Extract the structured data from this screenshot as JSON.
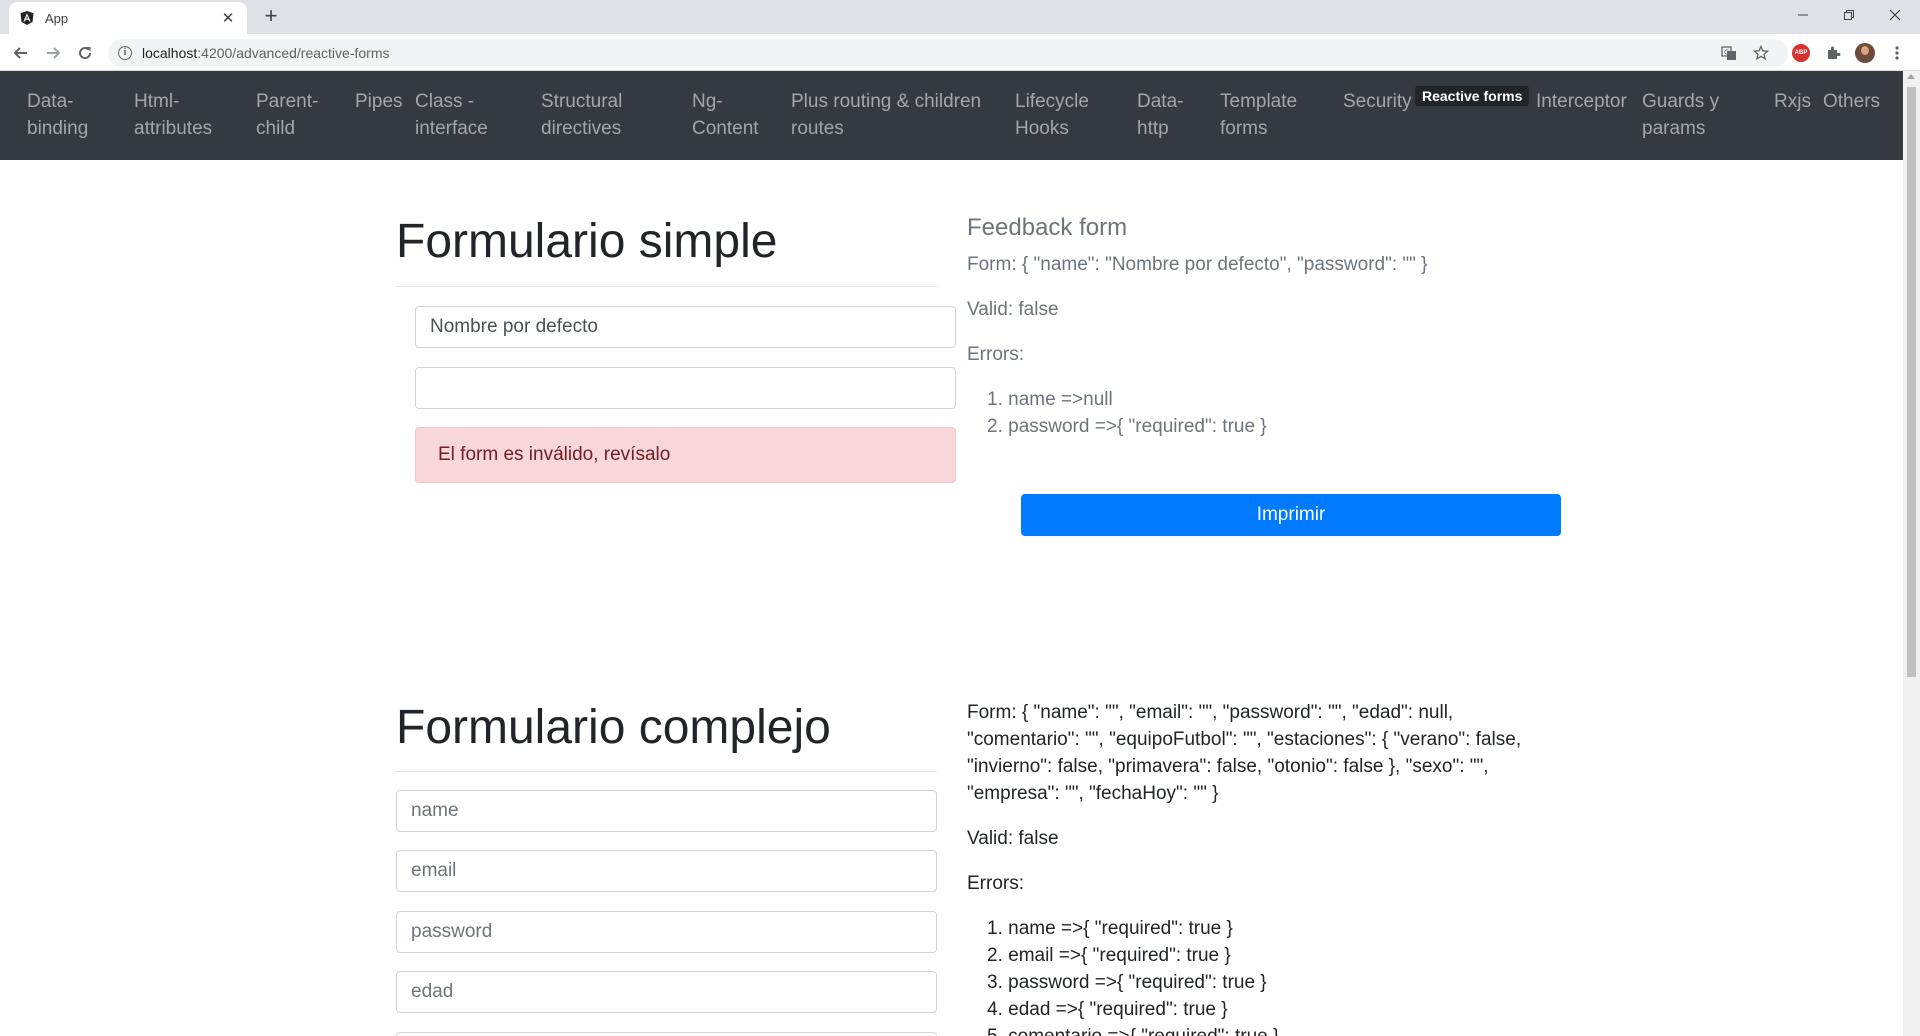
{
  "browser": {
    "tab_title": "App",
    "url_host": "localhost",
    "url_rest": ":4200/advanced/reactive-forms"
  },
  "nav": {
    "items": [
      "Data-\nbinding",
      "Html-\nattributes",
      "Parent-\nchild",
      "Pipes",
      "Class -\ninterface",
      "Structural\ndirectives",
      "Ng-\nContent",
      "Plus routing & children\nroutes",
      "Lifecycle\nHooks",
      "Data-\nhttp",
      "Template\nforms",
      "Security",
      "Interceptor",
      "Guards y\nparams",
      "Rxjs",
      "Others"
    ],
    "active": "Reactive forms"
  },
  "simple": {
    "title": "Formulario simple",
    "name_value": "Nombre por defecto",
    "password_value": "",
    "alert": "El form es inválido, revísalo"
  },
  "feedback": {
    "title": "Feedback form",
    "form_line": "Form: { \"name\": \"Nombre por defecto\", \"password\": \"\" }",
    "valid_line": "Valid: false",
    "errors_label": "Errors:",
    "errors": [
      "name =>null",
      "password =>{ \"required\": true }"
    ],
    "print_button": "Imprimir"
  },
  "complex": {
    "title": "Formulario complejo",
    "placeholders": [
      "name",
      "email",
      "password",
      "edad"
    ],
    "form_lines": [
      "Form: { \"name\": \"\", \"email\": \"\", \"password\": \"\", \"edad\": null,",
      "\"comentario\": \"\", \"equipoFutbol\": \"\", \"estaciones\": { \"verano\": false,",
      "\"invierno\": false, \"primavera\": false, \"otonio\": false }, \"sexo\": \"\",",
      "\"empresa\": \"\", \"fechaHoy\": \"\" }"
    ],
    "valid_line": "Valid: false",
    "errors_label": "Errors:",
    "errors": [
      "name =>{ \"required\": true }",
      "email =>{ \"required\": true }",
      "password =>{ \"required\": true }",
      "edad =>{ \"required\": true }",
      "comentario =>{ \"required\": true }"
    ]
  }
}
